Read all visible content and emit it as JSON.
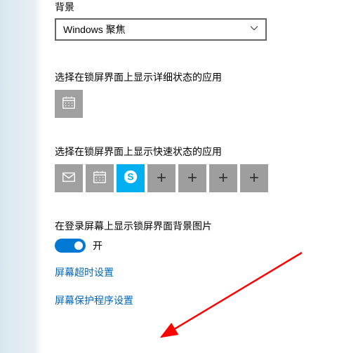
{
  "background": {
    "label": "背景",
    "dropdown_value": "Windows 聚焦"
  },
  "detailed_status": {
    "label": "选择在锁屏界面上显示详细状态的应用",
    "apps": [
      {
        "icon": "calendar-icon"
      }
    ]
  },
  "quick_status": {
    "label": "选择在锁屏界面上显示快速状态的应用",
    "apps": [
      {
        "icon": "mail-icon"
      },
      {
        "icon": "calendar-icon"
      },
      {
        "icon": "skype-icon"
      },
      {
        "icon": "plus-icon"
      },
      {
        "icon": "plus-icon"
      },
      {
        "icon": "plus-icon"
      },
      {
        "icon": "plus-icon"
      }
    ]
  },
  "signin_bg": {
    "label": "在登录屏幕上显示锁屏界面背景图片",
    "toggle_state": "on",
    "toggle_label": "开"
  },
  "links": {
    "timeout": "屏幕超时设置",
    "screensaver": "屏幕保护程序设置"
  }
}
